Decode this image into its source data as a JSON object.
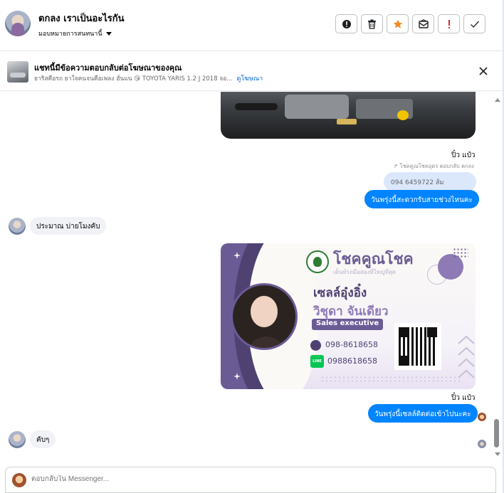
{
  "header": {
    "title": "ตกลง เราเป็นอะไรกัน",
    "assign_label": "มอบหมายการสนทนานี้",
    "toolbar": [
      {
        "name": "report-button",
        "icon": "alert-circle-icon"
      },
      {
        "name": "delete-button",
        "icon": "trash-icon"
      },
      {
        "name": "star-button",
        "icon": "star-icon"
      },
      {
        "name": "mark-unread-button",
        "icon": "envelope-icon"
      },
      {
        "name": "follow-up-button",
        "icon": "exclamation-icon"
      },
      {
        "name": "done-button",
        "icon": "check-icon"
      }
    ]
  },
  "ad_banner": {
    "title": "แชทนี้มีข้อความตอบกลับต่อโฆษณาของคุณ",
    "subtitle": "ยาริสคือรถ ยาใจคนจนคือเพลง ฮั่นแน 😘 TOYOTA YARIS 1.2 J 2018 จอ...",
    "link": "ดูโฆษณา"
  },
  "messages": {
    "sender_name_1": "ปิ๋ว แป๋ว",
    "reply_note": "↱ โชคคูณโชคอุดร ตอบกลับ ตกลง",
    "quoted_text": "094 6459722 ส้ม",
    "out_1": "วันพรุ่งนี้สะดวกรับสายช่วงไหนคะ",
    "in_1": "ประมาณ บ่ายโมงคับ",
    "sender_name_2": "ปิ๋ว แป๋ว",
    "out_2": "วันพรุ่งนี้เซลล์ติดต่อเข้าไปนะคะ",
    "in_2": "คับๆ"
  },
  "business_card": {
    "brand": "โชคคูณโชค",
    "tagline": "เต็นท์รถมือสองที่ใหญ่ที่สุด",
    "name_line1": "เซลล์อุ๋งอิ๋ง",
    "name_line2": "วิชุดา จันเดียว",
    "role": "Sales executive",
    "phone": "098-8618658",
    "line_id": "0988618658",
    "line_badge": "LINE",
    "colors": {
      "primary": "#6b5b95",
      "dark": "#4f4273",
      "light": "#8e7ab5"
    }
  },
  "composer": {
    "placeholder": "ตอบกลับใน Messenger..."
  },
  "colors": {
    "bubble_out": "#0084ff",
    "bubble_in": "#f0f2f5",
    "link": "#0064d1"
  }
}
